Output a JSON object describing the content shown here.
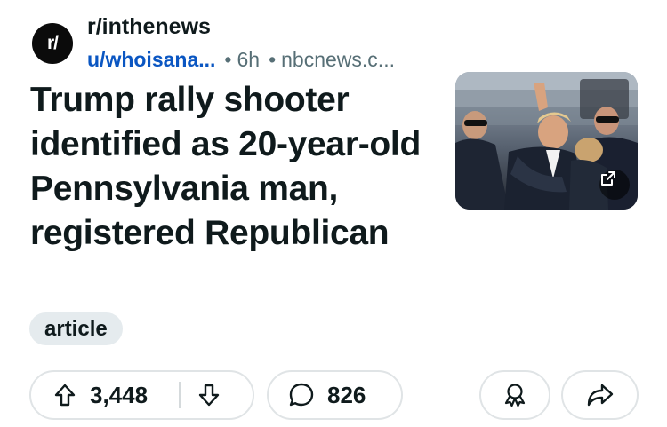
{
  "subreddit": {
    "avatar_text": "r/",
    "name": "r/inthenews"
  },
  "meta": {
    "user": "u/whoisana...",
    "age": "6h",
    "domain": "nbcnews.c...",
    "separator": "•"
  },
  "post": {
    "title": "Trump rally shooter identified as 20-year-old Pennsylvania man, registered Republican",
    "flair": "article"
  },
  "actions": {
    "votes": "3,448",
    "comments": "826"
  },
  "colors": {
    "link": "#0a56c2",
    "meta": "#576f76",
    "pill_border": "#e0e4e6",
    "flair_bg": "#e5ebee"
  },
  "icons": {
    "upvote": "arrow-up-icon",
    "downvote": "arrow-down-icon",
    "comment": "speech-bubble-icon",
    "award": "award-ribbon-icon",
    "share": "share-arrow-icon",
    "external": "external-link-icon"
  }
}
